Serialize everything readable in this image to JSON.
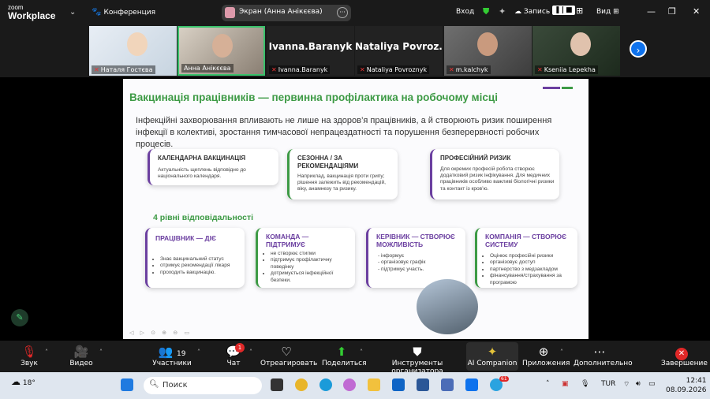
{
  "app": {
    "logo_top": "zoom",
    "logo_bottom": "Workplace",
    "meeting_label": "Конференция"
  },
  "screen_share": {
    "label": "Экран (Анна Анікєєва)"
  },
  "topbar": {
    "signin": "Вход",
    "record": "Запись",
    "view": "Вид"
  },
  "participants_strip": [
    {
      "name": "Наталя Гостєва",
      "big": ""
    },
    {
      "name": "Анна Анікєєва",
      "big": ""
    },
    {
      "name": "Ivanna.Baranyk",
      "big": "Ivanna.Baranyk"
    },
    {
      "name": "Nataliya Povroznyk",
      "big": "Nataliya  Povroz..."
    },
    {
      "name": "m.kalchyk",
      "big": ""
    },
    {
      "name": "Kseniia Lepekha",
      "big": ""
    }
  ],
  "slide": {
    "title": "Вакцинація працівників — первинна профілактика на робочому місці",
    "intro": "Інфекційні захворювання впливають не лише на здоров’я працівників, а й створюють ризик поширення інфекції в колективі, зростання тимчасової непрацездатності та порушення безперервності робочих процесів.",
    "cards": [
      {
        "title": "КАЛЕНДАРНА ВАКЦИНАЦІЯ",
        "body": "Актуальність щеплень відповідно до національного календаря."
      },
      {
        "title": "СЕЗОННА / ЗА РЕКОМЕНДАЦІЯМИ",
        "body": "Наприклад, вакцинація проти грипу; рішення залежить від рекомендацій, віку, анамнезу та ризику."
      },
      {
        "title": "ПРОФЕСІЙНИЙ РИЗИК",
        "body": "Для окремих професій робота створює додатковий ризик інфікування. Для медичних працівників особливо важливі біологічні ризики та контакт із кров’ю."
      }
    ],
    "levels_heading": "4 рівні відповідальності",
    "levels": [
      {
        "title": "ПРАЦІВНИК — ДІЄ",
        "items": [
          "Знає вакцинальний статус",
          "отримує рекомендації лікаря",
          "проходить вакцинацію."
        ]
      },
      {
        "title": "КОМАНДА — ПІДТРИМУЄ",
        "items": [
          "не створює стигми",
          "підтримує профілактичну поведінку",
          "дотримується інфекційної безпеки."
        ]
      },
      {
        "title": "КЕРІВНИК — СТВОРЮЄ МОЖЛИВІСТЬ",
        "items": [
          "інформує",
          "організовує графік",
          "підтримує участь."
        ]
      },
      {
        "title": "КОМПАНІЯ — СТВОРЮЄ СИСТЕМУ",
        "items": [
          "Оцінює професійні ризики",
          "організовує доступ",
          "партнерство з медзакладом",
          "фінансування/страхування за програмою"
        ]
      }
    ]
  },
  "toolbar": {
    "mute": "Звук",
    "video": "Видео",
    "participants": "Участники",
    "participants_count": "19",
    "chat": "Чат",
    "chat_badge": "1",
    "react": "Отреагировать",
    "share": "Поделиться",
    "host_tools": "Инструменты организатора",
    "ai": "AI Companion",
    "apps": "Приложения",
    "more": "Дополнительно",
    "end": "Завершение"
  },
  "taskbar": {
    "temp": "18°",
    "search_placeholder": "Поиск",
    "lang": "TUR",
    "time": "12:41",
    "date": "08.09.2026",
    "telegram_badge": "61"
  },
  "colors": {
    "accent_green": "#3d9a45",
    "accent_purple": "#6b3fa0",
    "zoom_blue": "#0e72ed",
    "end_red": "#e02828"
  }
}
